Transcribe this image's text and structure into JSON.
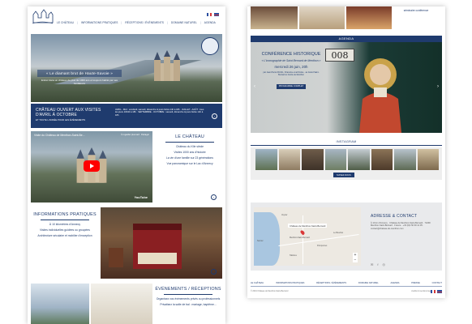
{
  "colors": {
    "navy": "#1f3b6e",
    "band": "#1f3b6e",
    "youtube_red": "#ff0000"
  },
  "left": {
    "nav": [
      {
        "label": "Le Château"
      },
      {
        "label": "Informations pratiques"
      },
      {
        "label": "Réceptions / Événements"
      },
      {
        "label": "Domaine Naturel"
      },
      {
        "label": "Agenda"
      }
    ],
    "hero": {
      "title": "« Le diamant brut de Haute-Savoie »",
      "subtitle": "Entrez dans un château de plus de 1000 ans et toujours habité par ses fondateurs"
    },
    "band": {
      "title": "Château ouvert aux visites d'avril à octobre",
      "subtitle": "et toute l'année pour les événements",
      "info": "AVRIL - MAI : vendredi, samedi, dimanche & jours fériés 14h à 18h · JUILLET - AOÛT : tous les jours 10h30 à 18h · SEPTEMBRE - OCTOBRE : samedi, dimanche & jours fériés 14h à 18h"
    },
    "video": {
      "title": "Visite du Château de Menthon-Saint-Be...",
      "later": "À regarder plus tard",
      "share": "Partager",
      "brand": "YouTube"
    },
    "chateau": {
      "title": "Le Château",
      "lines": [
        "Château du XIIe siècle",
        "Visites 1000 ans d'histoire",
        "La vie d'une famille sur 23 générations",
        "Vue panoramique sur le Lac d'Annecy"
      ]
    },
    "infos": {
      "title": "Informations pratiques",
      "lines": [
        "À 10 kilomètres d'Annecy",
        "Visites individuelles guidées ou groupées",
        "Architecture séculaire et mobilier d'exception"
      ]
    },
    "events": {
      "title": "Événements / Réceptions",
      "lines": [
        "Organisez vos événements privés ou professionnels",
        "Privatisez la salle de bal : mariage, baptême..."
      ]
    }
  },
  "right": {
    "seminar": "séminaire conférence",
    "agenda": {
      "bar": "Agenda",
      "heading": "Conférence historique",
      "subtitle": "« L'iconographie de Saint Bernard de Menthon »",
      "date": "mercredi 26 juin, 20h",
      "details": "par Jean-Pierre DUVAL, Chanoine et archiviste · au Grand Saint-Bernard et Cécile de Menthon",
      "button": "Programme complet",
      "sign": "008"
    },
    "instagram": {
      "title": "Instagram",
      "button": "Suivez-nous"
    },
    "map": {
      "pin_label": "Château de Menthon-Saint-Bernard",
      "towns": [
        "Veyrier",
        "Menthon-Saint-Bernard",
        "Talloires",
        "Pomponnet",
        "Le Bouchet",
        "Sévrier"
      ]
    },
    "address": {
      "title": "Adresse & Contact",
      "text": "À 10 km d'Annecy · Château de Menthon-Saint-Bernard · 74290 Menthon-Saint-Bernard · France · +33 (0)4 50 60 12 05 · contact@chateau-de-menthon.com"
    },
    "footer": {
      "nav": [
        "Le Château",
        "Informations pratiques",
        "Réceptions / Événements",
        "Domaine Naturel",
        "Agenda",
        "Presse",
        "Contact"
      ],
      "copy": "© 2019 Château de Menthon-Saint-Bernard",
      "legal": "crédits & mentions légales"
    }
  }
}
